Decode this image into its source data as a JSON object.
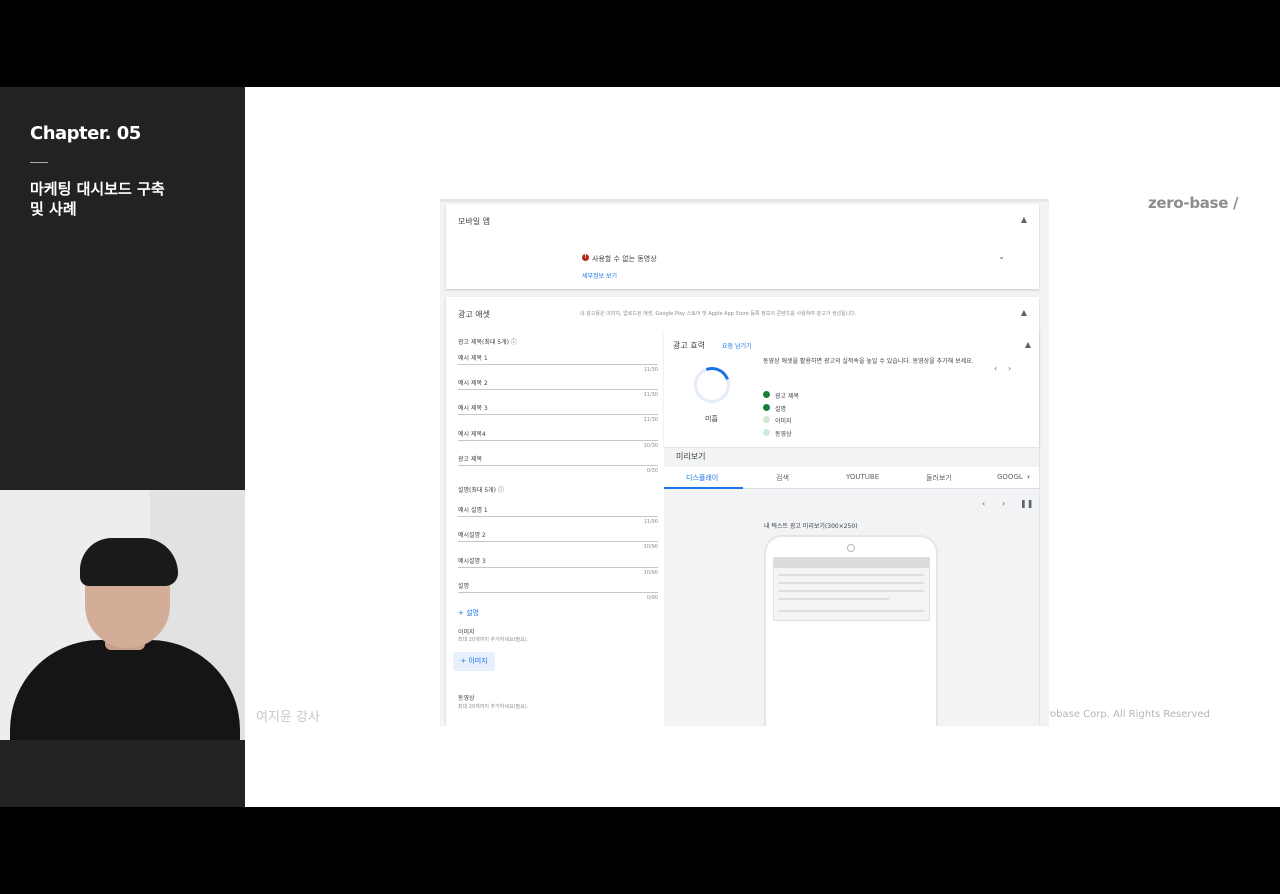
{
  "sidebar": {
    "chapter": "Chapter. 05",
    "lesson_line1": "마케팅 대시보드 구축",
    "lesson_line2": "및 사례",
    "instructor": "여지윤 강사"
  },
  "branding": {
    "logo": "zero-base /",
    "copyright": "erobase Corp. All Rights Reserved"
  },
  "mobile_app": {
    "title": "모바일 앱",
    "error_icon": "!",
    "error_text": "사용할 수 없는 동영상",
    "details_link": "세부정보 보기"
  },
  "ad_assets": {
    "title": "광고 애셋",
    "description": "내 광고용은 이미지, 업로드된 애셋, Google Play 스토어 및 Apple App Store 등록 정보의 콘텐츠를 사용하여 광고가 생성됩니다.",
    "headlines_label": "광고 제목(최대 5개)",
    "headlines": [
      {
        "value": "예시 제목 1",
        "count": "11/30"
      },
      {
        "value": "예시 제목 2",
        "count": "11/30"
      },
      {
        "value": "예시 제목 3",
        "count": "11/30"
      },
      {
        "value": "예시 제목4",
        "count": "10/30"
      },
      {
        "value": "광고 제목",
        "count": "0/30"
      }
    ],
    "descriptions_label": "설명(최대 5개)",
    "descriptions": [
      {
        "value": "예시 설명 1",
        "count": "11/90"
      },
      {
        "value": "예시설명 2",
        "count": "10/90"
      },
      {
        "value": "예시설명 3",
        "count": "10/90"
      },
      {
        "value": "설명",
        "count": "0/90"
      }
    ],
    "add_description": "+ 설명",
    "images_label": "이미지",
    "images_hint": "최대 20개까지 추가하세요(필요).",
    "add_image": "+ 이미지",
    "videos_label": "동영상",
    "videos_hint": "최대 20개까지 추가하세요(필요)."
  },
  "ad_strength": {
    "title": "광고 효력",
    "hide_link": "요점 남기기",
    "rating": "미흡",
    "tip": "동영상 애셋을 활용하면 광고의 실적속을 높일 수 있습니다. 동영상을 추가해 보세요.",
    "checks": [
      {
        "label": "광고 제목",
        "color": "#188038"
      },
      {
        "label": "설명",
        "color": "#188038"
      },
      {
        "label": "이미지",
        "color": "#ceead6"
      },
      {
        "label": "동영상",
        "color": "#ceead6"
      }
    ]
  },
  "preview": {
    "title": "미리보기",
    "tabs": [
      "디스플레이",
      "검색",
      "YOUTUBE",
      "둘러보기",
      "GOOGL"
    ],
    "caption": "내 텍스트 광고 미리보기(300×250)"
  }
}
